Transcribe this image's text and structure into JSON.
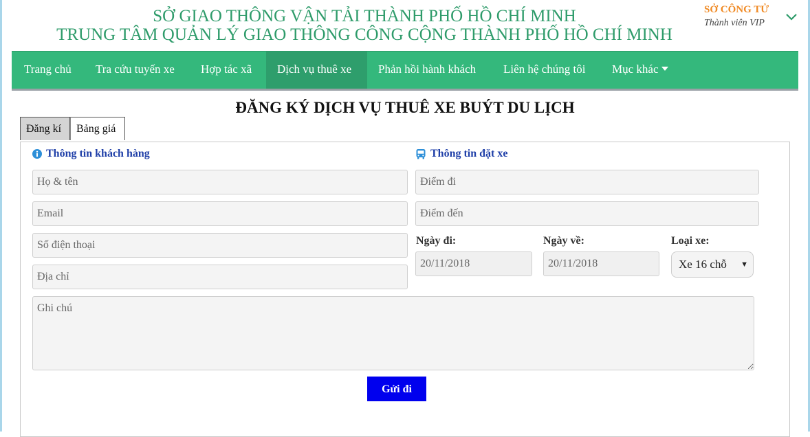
{
  "header": {
    "line1": "SỞ GIAO THÔNG VẬN TẢI THÀNH PHỐ HỒ CHÍ MINH",
    "line2": "TRUNG TÂM QUẢN LÝ GIAO THÔNG CÔNG CỘNG THÀNH PHỐ HỒ CHÍ MINH"
  },
  "user": {
    "name": "SỞ CÔNG TỬ",
    "role": "Thành viên VIP",
    "chevron_icon": "chevron-down-icon"
  },
  "nav": {
    "items": [
      {
        "label": "Trang chủ"
      },
      {
        "label": "Tra cứu tuyến xe"
      },
      {
        "label": "Hợp tác xã"
      },
      {
        "label": "Dịch vụ thuê xe"
      },
      {
        "label": "Phản hồi hành khách"
      },
      {
        "label": "Liên hệ chúng tôi"
      },
      {
        "label": "Mục khác"
      }
    ],
    "active": "Dịch vụ thuê xe",
    "color": "#34b87c"
  },
  "page": {
    "title": "ĐĂNG KÝ DỊCH VỤ THUÊ XE BUÝT DU LỊCH"
  },
  "tabs": [
    {
      "label": "Đăng kí"
    },
    {
      "label": "Bảng giá"
    }
  ],
  "customer": {
    "heading": "Thông tin khách hàng",
    "icon": "info-icon",
    "name_placeholder": "Họ & tên",
    "email_placeholder": "Email",
    "phone_placeholder": "Số điện thoại",
    "address_placeholder": "Địa chỉ"
  },
  "booking": {
    "heading": "Thông tin đặt xe",
    "icon": "bus-icon",
    "from_placeholder": "Điểm đi",
    "to_placeholder": "Điểm đến",
    "depart_label": "Ngày đi:",
    "depart_value": "20/11/2018",
    "return_label": "Ngày về:",
    "return_value": "20/11/2018",
    "type_label": "Loại xe:",
    "type_value": "Xe 16 chỗ"
  },
  "notes": {
    "placeholder": "Ghi chú"
  },
  "submit": {
    "label": "Gửi đi",
    "color": "#0000ee"
  }
}
